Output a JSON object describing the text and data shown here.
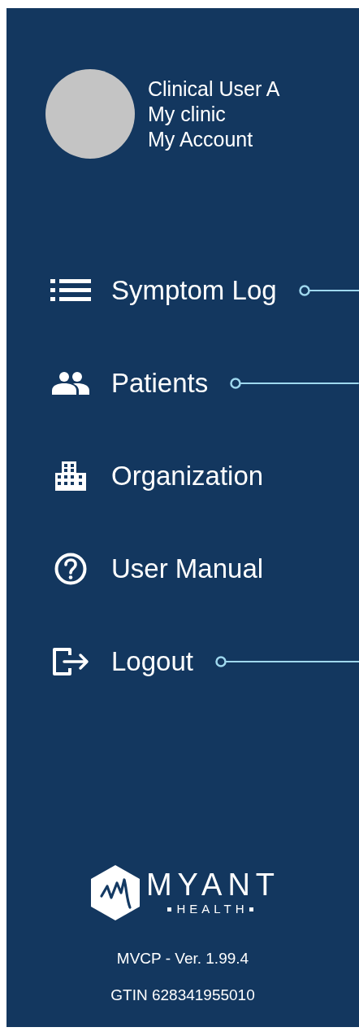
{
  "profile": {
    "name": "Clinical User A",
    "clinic": "My clinic",
    "account_link": "My Account"
  },
  "menu": [
    {
      "kind": "list",
      "label": "Symptom Log",
      "callout": true
    },
    {
      "kind": "people",
      "label": "Patients",
      "callout": true
    },
    {
      "kind": "building",
      "label": "Organization",
      "callout": false
    },
    {
      "kind": "help",
      "label": "User Manual",
      "callout": false
    },
    {
      "kind": "logout",
      "label": "Logout",
      "callout": true
    }
  ],
  "brand": {
    "name": "MYANT",
    "subtitle": "HEALTH"
  },
  "version": "MVCP - Ver. 1.99.4",
  "gtin": "GTIN 628341955010"
}
